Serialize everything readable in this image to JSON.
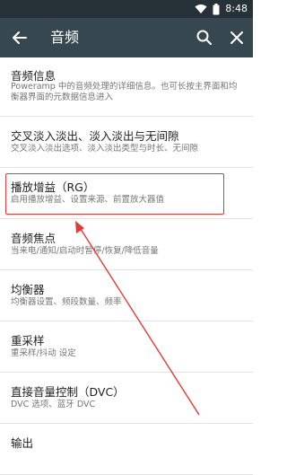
{
  "status_bar": {
    "time": "8:48",
    "icons": [
      "wifi-icon",
      "battery-icon"
    ]
  },
  "app_bar": {
    "title": "音频",
    "back_icon": "arrow-left-icon",
    "search_icon": "search-icon",
    "close_icon": "close-icon"
  },
  "items": [
    {
      "title": "音频信息",
      "summary": "Poweramp 中的音频处理的详细信息。也可长按主界面和均衡器界面的元数据信息进入"
    },
    {
      "title": "交叉淡入淡出、淡入淡出与无间隙",
      "summary": "交叉淡入淡出选项、淡入淡出类型与时长、无间隙"
    },
    {
      "title": "播放增益（RG）",
      "summary": "启用播放增益、设置来源、前置放大器值"
    },
    {
      "title": "音频焦点",
      "summary": "当来电/通知/启动时暂停/恢复/降低音量"
    },
    {
      "title": "均衡器",
      "summary": "均衡器设置、频段数量、频率"
    },
    {
      "title": "重采样",
      "summary": "重采样/抖动 设定"
    },
    {
      "title": "直接音量控制（DVC）",
      "summary": "DVC 选项、蓝牙 DVC"
    },
    {
      "title": "输出",
      "summary": ""
    }
  ],
  "colors": {
    "status_bar": "#263238",
    "app_bar": "#37474f",
    "annotation": "#e53935"
  }
}
